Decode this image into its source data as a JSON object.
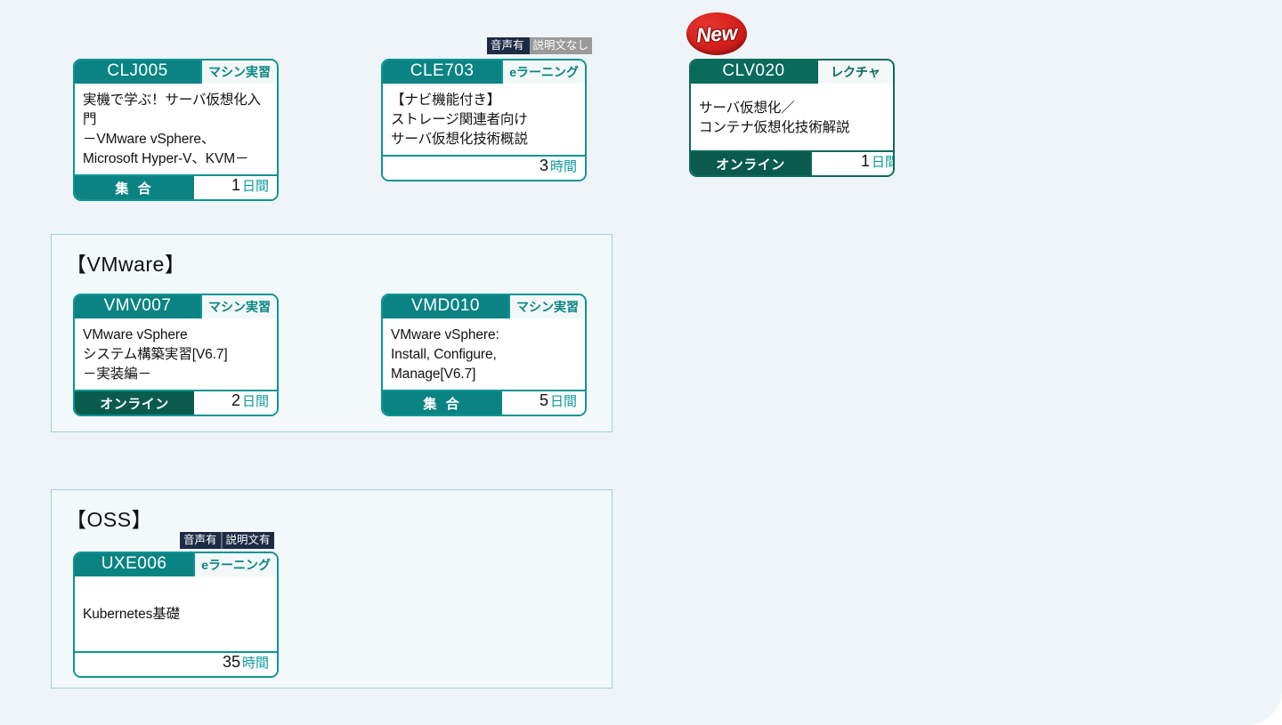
{
  "page": {
    "background_color": "#eef4f7",
    "accent_teal": "#0b8383",
    "accent_dark_green": "#0a5b4c",
    "border_teal": "#0d9494",
    "badge_navy": "#1d2b45",
    "badge_gray": "#9a9a9a",
    "new_red": "#d4201c"
  },
  "new_badge": {
    "label": "New"
  },
  "top_cards": [
    {
      "code": "CLJ005",
      "kind": "マシン実習",
      "kind_style": "machine",
      "title": "実機で学ぶ！サーバ仮想化入門\n－VMware vSphere、\nMicrosoft Hyper-V、KVM－",
      "mode": "集 合",
      "mode_style": "onsite",
      "duration_value": "1",
      "duration_unit": "日間",
      "header_style": "teal",
      "media_badge": null
    },
    {
      "code": "CLE703",
      "kind": "eラーニング",
      "kind_style": "elearning",
      "title": "【ナビ機能付き】\nストレージ関連者向け\nサーバ仮想化技術概説",
      "mode": "",
      "mode_style": "none",
      "duration_value": "3",
      "duration_unit": "時間",
      "header_style": "teal",
      "media_badge": {
        "audio": "音声有",
        "audio_style": "navy",
        "caption": "説明文なし",
        "caption_style": "gray"
      }
    },
    {
      "code": "CLV020",
      "kind": "レクチャ",
      "kind_style": "lecture",
      "title": "サーバ仮想化／\nコンテナ仮想化技術解説",
      "mode": "オンライン",
      "mode_style": "online",
      "duration_value": "1",
      "duration_unit": "日間",
      "header_style": "dark",
      "media_badge": null
    }
  ],
  "sections": [
    {
      "title": "【VMware】",
      "cards": [
        {
          "code": "VMV007",
          "kind": "マシン実習",
          "kind_style": "machine",
          "title": "VMware vSphere\nシステム構築実習[V6.7]\n－実装編－",
          "mode": "オンライン",
          "mode_style": "online",
          "duration_value": "2",
          "duration_unit": "日間",
          "header_style": "teal",
          "media_badge": null
        },
        {
          "code": "VMD010",
          "kind": "マシン実習",
          "kind_style": "machine",
          "title": "VMware vSphere:\nInstall, Configure,\nManage[V6.7]",
          "mode": "集 合",
          "mode_style": "onsite",
          "duration_value": "5",
          "duration_unit": "日間",
          "header_style": "teal",
          "media_badge": null
        }
      ]
    },
    {
      "title": "【OSS】",
      "cards": [
        {
          "code": "UXE006",
          "kind": "eラーニング",
          "kind_style": "elearning",
          "title": "Kubernetes基礎",
          "mode": "",
          "mode_style": "none",
          "duration_value": "35",
          "duration_unit": "時間",
          "header_style": "teal",
          "media_badge": {
            "audio": "音声有",
            "audio_style": "navy",
            "caption": "説明文有",
            "caption_style": "navy"
          }
        }
      ]
    }
  ]
}
